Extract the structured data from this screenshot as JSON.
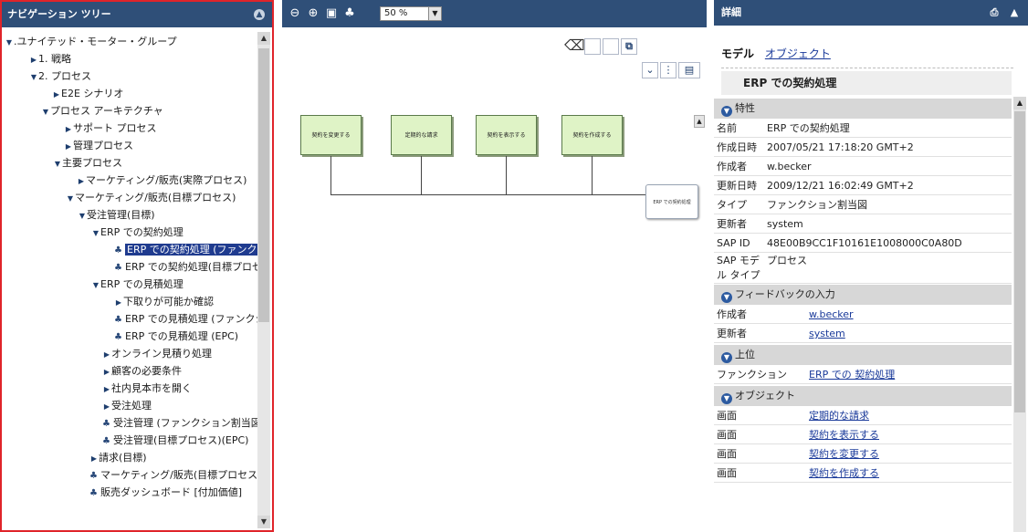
{
  "nav": {
    "title": "ナビゲーション ツリー",
    "items": [
      {
        "label": ".ユナイテッド・モーター・グループ",
        "expanded": true
      },
      {
        "label": "1. 戦略",
        "expanded": false
      },
      {
        "label": "2. プロセス",
        "expanded": true
      },
      {
        "label": "E2E シナリオ",
        "expanded": false
      },
      {
        "label": "プロセス アーキテクチャ",
        "expanded": true
      },
      {
        "label": "サポート プロセス",
        "expanded": false
      },
      {
        "label": "管理プロセス",
        "expanded": false
      },
      {
        "label": "主要プロセス",
        "expanded": true
      },
      {
        "label": "マーケティング/販売(実際プロセス)",
        "expanded": false
      },
      {
        "label": "マーケティング/販売(目標プロセス)",
        "expanded": true
      },
      {
        "label": "受注管理(目標)",
        "expanded": true
      },
      {
        "label": "ERP での契約処理",
        "expanded": true
      },
      {
        "label": "ERP での契約処理 (ファンクション割当図)",
        "selected": true
      },
      {
        "label": "ERP での契約処理(目標プロセス)"
      },
      {
        "label": "ERP での見積処理",
        "expanded": true
      },
      {
        "label": "下取りが可能か確認",
        "expanded": false
      },
      {
        "label": "ERP での見積処理 (ファンクション割当図)"
      },
      {
        "label": "ERP での見積処理 (EPC)"
      },
      {
        "label": "オンライン見積り処理",
        "expanded": false
      },
      {
        "label": "顧客の必要条件",
        "expanded": false
      },
      {
        "label": "社内見本市を開く",
        "expanded": false
      },
      {
        "label": "受注処理",
        "expanded": false
      },
      {
        "label": "受注管理 (ファンクション割当図)"
      },
      {
        "label": "受注管理(目標プロセス)(EPC)"
      },
      {
        "label": "請求(目標)",
        "expanded": false
      },
      {
        "label": "マーケティング/販売(目標プロセス)"
      },
      {
        "label": "販売ダッシュボード [付加価値]"
      }
    ]
  },
  "center": {
    "zoom": "50 %",
    "functions": [
      "契約を変更する",
      "定期的な請求",
      "契約を表示する",
      "契約を作成する"
    ],
    "event": "ERP での契約処理"
  },
  "detail": {
    "title": "詳細",
    "tab_model": "モデル",
    "tab_object": "オブジェクト",
    "object_title": "ERP での契約処理",
    "sections": {
      "attributes": "特性",
      "feedback": "フィードバックの入力",
      "parent": "上位",
      "objects": "オブジェクト"
    },
    "attributes": [
      {
        "k": "名前",
        "v": "ERP での契約処理"
      },
      {
        "k": "作成日時",
        "v": "2007/05/21 17:18:20 GMT+2"
      },
      {
        "k": "作成者",
        "v": "w.becker"
      },
      {
        "k": "更新日時",
        "v": "2009/12/21 16:02:49 GMT+2"
      },
      {
        "k": "タイプ",
        "v": "ファンクション割当図"
      },
      {
        "k": "更新者",
        "v": "system"
      },
      {
        "k": "SAP ID",
        "v": "48E00B9CC1F10161E1008000C0A80D"
      },
      {
        "k": "SAP モデル タイプ",
        "v": "プロセス"
      }
    ],
    "feedback": [
      {
        "k": "作成者",
        "v": "w.becker"
      },
      {
        "k": "更新者",
        "v": "system"
      }
    ],
    "parent": [
      {
        "k": "ファンクション",
        "v": "ERP での 契約処理"
      }
    ],
    "objects": [
      {
        "k": "画面",
        "v": "定期的な請求"
      },
      {
        "k": "画面",
        "v": "契約を表示する"
      },
      {
        "k": "画面",
        "v": "契約を変更する"
      },
      {
        "k": "画面",
        "v": "契約を作成する"
      }
    ]
  }
}
